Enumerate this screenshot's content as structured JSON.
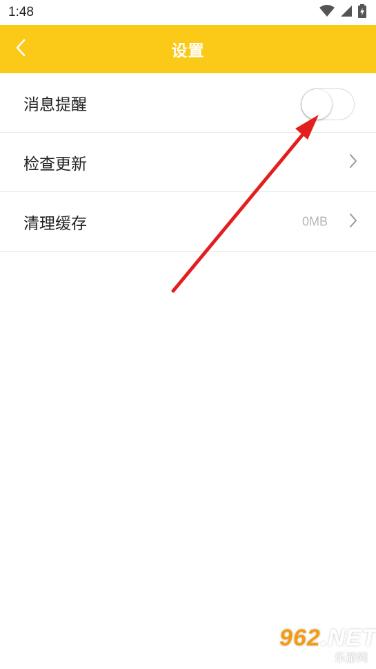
{
  "status_bar": {
    "time": "1:48",
    "icons": [
      "wifi-icon",
      "signal-icon",
      "battery-icon"
    ]
  },
  "app_bar": {
    "title": "设置",
    "back_icon": "chevron-left-icon",
    "background": "#FBC918"
  },
  "settings": {
    "items": [
      {
        "label": "消息提醒",
        "control": "toggle",
        "toggle_on": false
      },
      {
        "label": "检查更新",
        "control": "chevron"
      },
      {
        "label": "清理缓存",
        "value": "0MB",
        "control": "chevron"
      }
    ]
  },
  "overlay": {
    "annotation_arrow_color": "#e31e1e"
  },
  "watermark": {
    "brand_orange": "962",
    "brand_white": ".NET",
    "subtitle": "乐游网"
  }
}
